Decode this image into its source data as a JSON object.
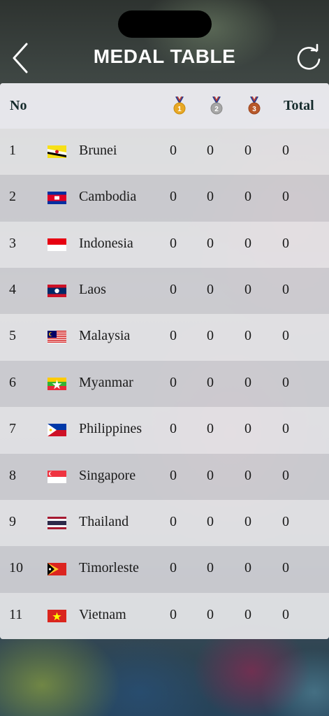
{
  "header": {
    "title": "MEDAL TABLE",
    "back_icon": "chevron-left-icon",
    "refresh_icon": "refresh-icon"
  },
  "table": {
    "col_no": "No",
    "col_total": "Total",
    "medal_icons": [
      "gold-medal-icon",
      "silver-medal-icon",
      "bronze-medal-icon"
    ],
    "medal_numbers": [
      "1",
      "2",
      "3"
    ],
    "rows": [
      {
        "no": "1",
        "country": "Brunei",
        "flag": "brunei-flag-icon",
        "gold": "0",
        "silver": "0",
        "bronze": "0",
        "total": "0"
      },
      {
        "no": "2",
        "country": "Cambodia",
        "flag": "cambodia-flag-icon",
        "gold": "0",
        "silver": "0",
        "bronze": "0",
        "total": "0"
      },
      {
        "no": "3",
        "country": "Indonesia",
        "flag": "indonesia-flag-icon",
        "gold": "0",
        "silver": "0",
        "bronze": "0",
        "total": "0"
      },
      {
        "no": "4",
        "country": "Laos",
        "flag": "laos-flag-icon",
        "gold": "0",
        "silver": "0",
        "bronze": "0",
        "total": "0"
      },
      {
        "no": "5",
        "country": "Malaysia",
        "flag": "malaysia-flag-icon",
        "gold": "0",
        "silver": "0",
        "bronze": "0",
        "total": "0"
      },
      {
        "no": "6",
        "country": "Myanmar",
        "flag": "myanmar-flag-icon",
        "gold": "0",
        "silver": "0",
        "bronze": "0",
        "total": "0"
      },
      {
        "no": "7",
        "country": "Philippines",
        "flag": "philippines-flag-icon",
        "gold": "0",
        "silver": "0",
        "bronze": "0",
        "total": "0"
      },
      {
        "no": "8",
        "country": "Singapore",
        "flag": "singapore-flag-icon",
        "gold": "0",
        "silver": "0",
        "bronze": "0",
        "total": "0"
      },
      {
        "no": "9",
        "country": "Thailand",
        "flag": "thailand-flag-icon",
        "gold": "0",
        "silver": "0",
        "bronze": "0",
        "total": "0"
      },
      {
        "no": "10",
        "country": "Timorleste",
        "flag": "timorleste-flag-icon",
        "gold": "0",
        "silver": "0",
        "bronze": "0",
        "total": "0"
      },
      {
        "no": "11",
        "country": "Vietnam",
        "flag": "vietnam-flag-icon",
        "gold": "0",
        "silver": "0",
        "bronze": "0",
        "total": "0"
      }
    ]
  },
  "colors": {
    "gold": "#e8a825",
    "silver": "#a6a6a6",
    "bronze": "#b8592a",
    "header_text": "#152b2c"
  }
}
